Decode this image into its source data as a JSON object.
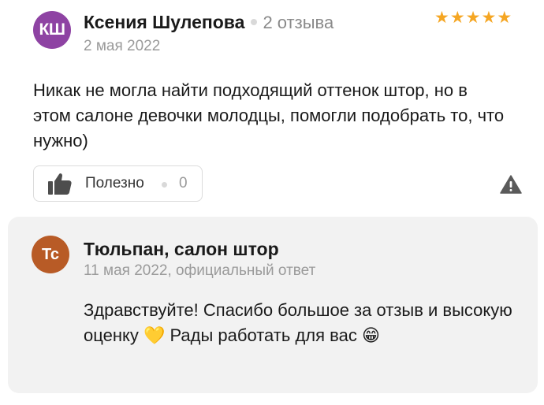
{
  "review": {
    "author": {
      "initials": "КШ",
      "name": "Ксения Шулепова",
      "review_count": "2 отзыва",
      "avatar_color": "#8e43a3"
    },
    "date": "2 мая 2022",
    "rating": 5,
    "stars": [
      "★",
      "★",
      "★",
      "★",
      "★"
    ],
    "star_color": "#f5a623",
    "text": "Никак не могла найти подходящий оттенок штор, но в этом салоне девочки молодцы, помогли подобрать то, что нужно)",
    "useful": {
      "label": "Полезно",
      "count": "0",
      "icon": "thumbs-up-icon"
    },
    "report_icon": "warning-icon"
  },
  "reply": {
    "org": {
      "initials": "Тс",
      "name": "Тюльпан, салон штор",
      "avatar_color": "#b85b26"
    },
    "meta": "11 мая 2022, официальный ответ",
    "text": "Здравствуйте! Спасибо большое за отзыв и высокую оценку 💛 Рады работать для вас 😁"
  }
}
